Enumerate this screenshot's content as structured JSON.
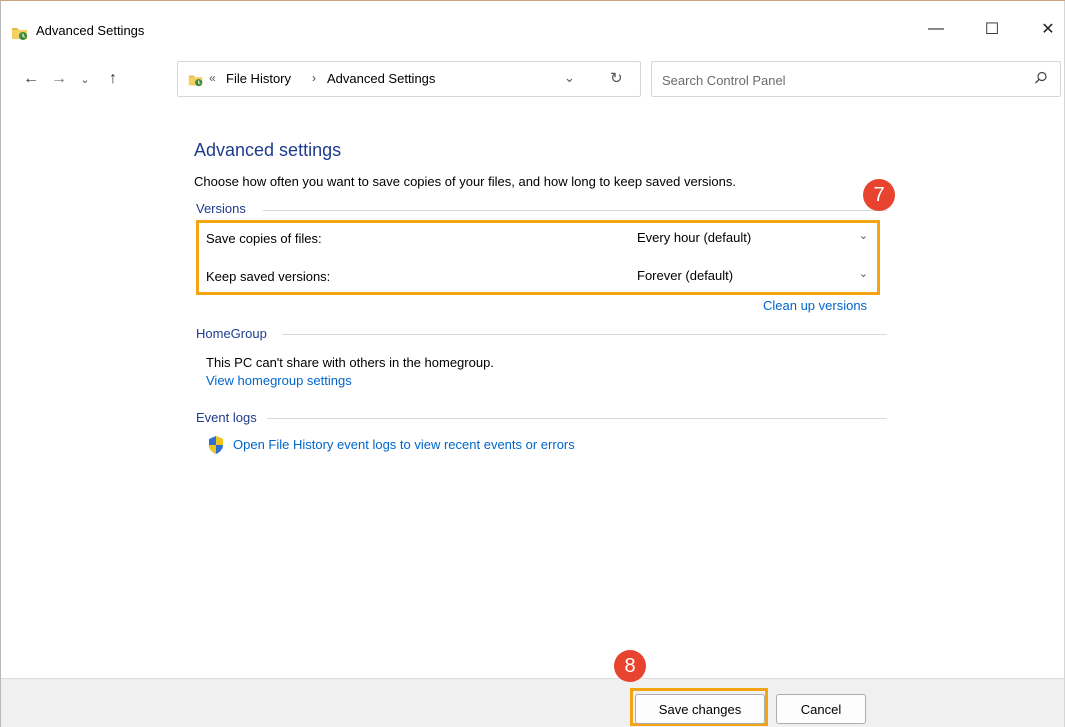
{
  "window": {
    "title": "Advanced Settings",
    "controls": {
      "minimize": "—",
      "maximize": "☐",
      "close": "✕"
    }
  },
  "nav": {
    "back": "←",
    "forward": "→",
    "recent": "⌄",
    "up": "↑",
    "breadcrumb_overflow": "«",
    "breadcrumb": [
      "File History",
      "Advanced Settings"
    ],
    "breadcrumb_separator": "›",
    "dropdown": "⌄",
    "refresh": "↻"
  },
  "search": {
    "placeholder": "Search Control Panel",
    "value": ""
  },
  "main": {
    "heading": "Advanced settings",
    "description": "Choose how often you want to save copies of your files, and how long to keep saved versions.",
    "versions": {
      "label": "Versions",
      "save_copies_label": "Save copies of files:",
      "save_copies_value": "Every hour (default)",
      "keep_versions_label": "Keep saved versions:",
      "keep_versions_value": "Forever (default)",
      "cleanup_link": "Clean up versions"
    },
    "homegroup": {
      "label": "HomeGroup",
      "text": "This PC can't share with others in the homegroup.",
      "link": "View homegroup settings"
    },
    "event_logs": {
      "label": "Event logs",
      "link": "Open File History event logs to view recent events or errors"
    }
  },
  "annotations": {
    "step7": "7",
    "step8": "8"
  },
  "footer": {
    "save_label": "Save changes",
    "cancel_label": "Cancel"
  },
  "colors": {
    "accent_heading": "#1e3c8c",
    "link": "#0066cc",
    "highlight": "#f2a413",
    "badge": "#e8432e"
  }
}
